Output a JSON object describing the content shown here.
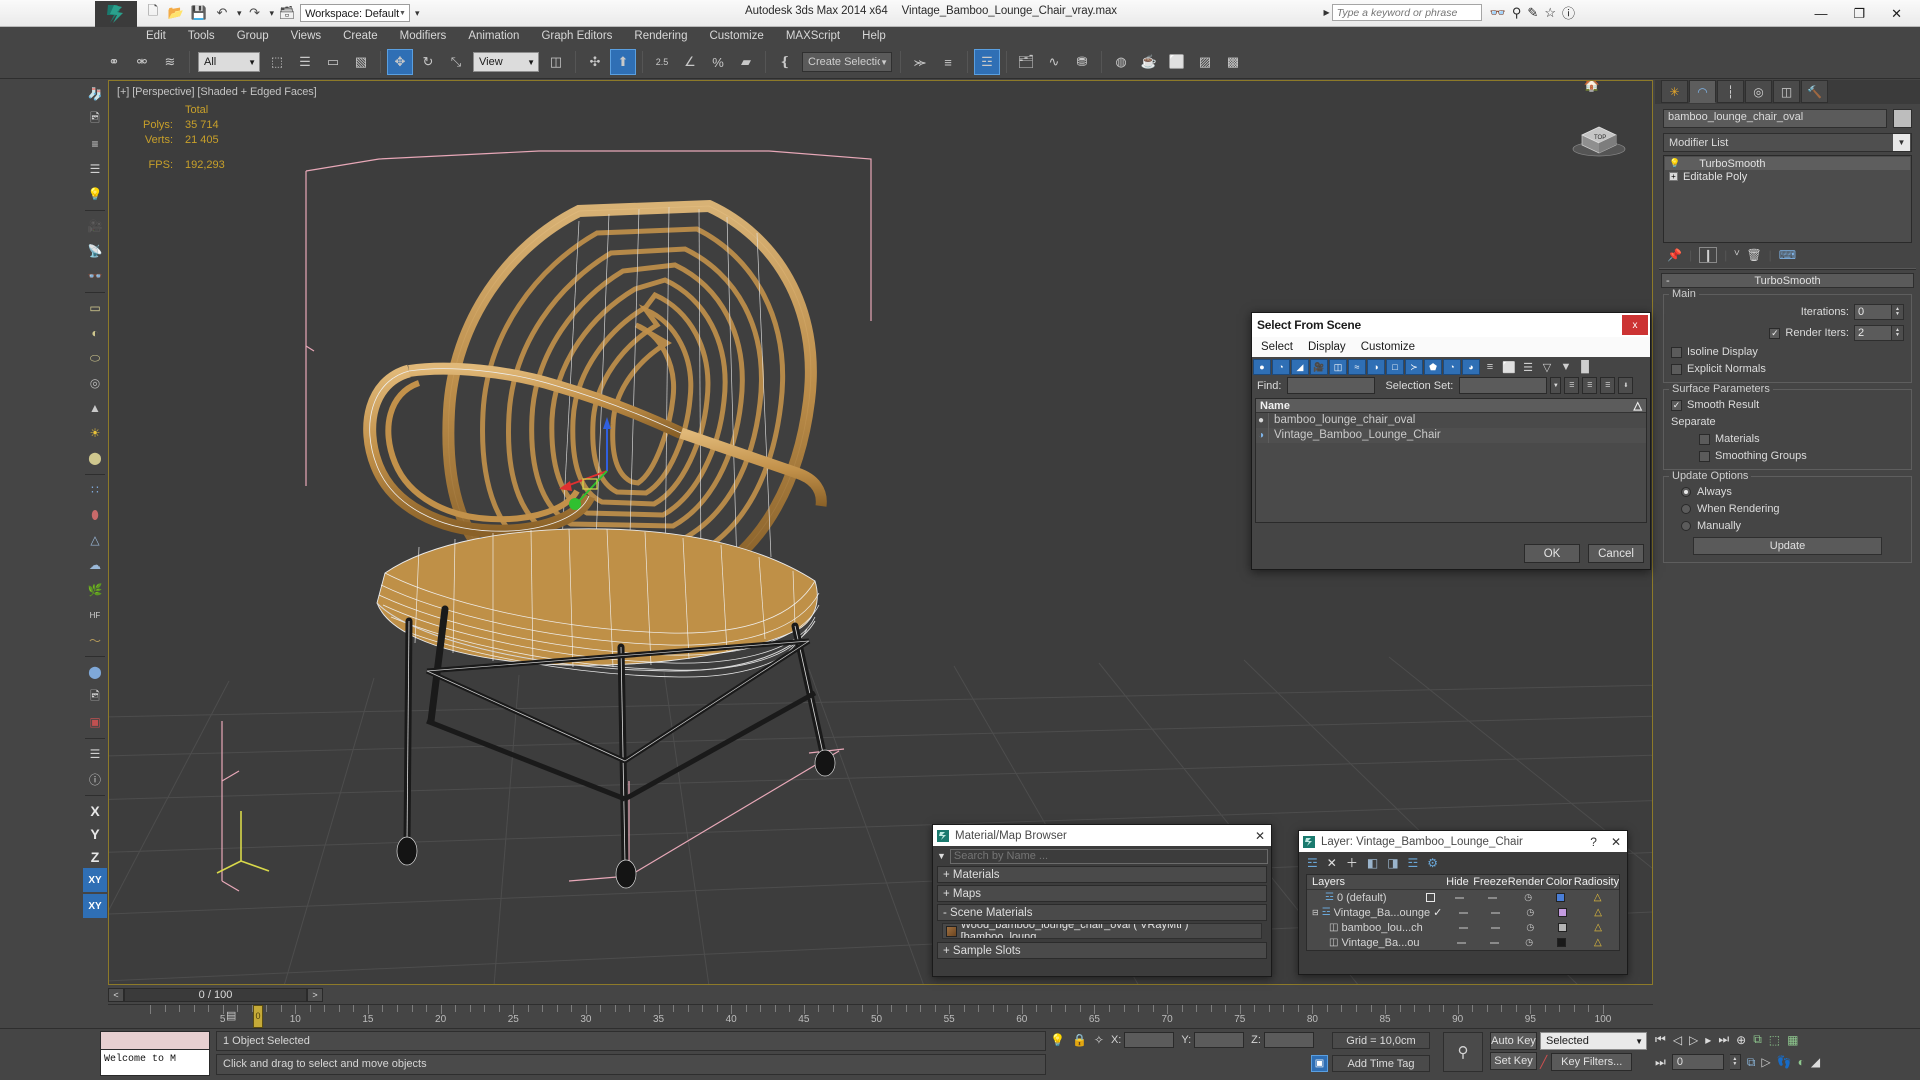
{
  "app": {
    "title": "Autodesk 3ds Max  2014 x64",
    "file": "Vintage_Bamboo_Lounge_Chair_vray.max",
    "workspace_label": "Workspace: Default"
  },
  "quick_access": [
    {
      "name": "new-icon",
      "glyph": "⬜"
    },
    {
      "name": "open-icon",
      "glyph": "📂"
    },
    {
      "name": "save-icon",
      "glyph": "💾"
    },
    {
      "name": "undo-icon",
      "glyph": "↶"
    },
    {
      "name": "redo-icon",
      "glyph": "↷"
    },
    {
      "name": "project-folder-icon",
      "glyph": "🗂"
    }
  ],
  "search": {
    "placeholder": "Type a keyword or phrase",
    "icons": [
      {
        "name": "search-binoculars-icon",
        "glyph": "⚕"
      },
      {
        "name": "search-key-icon",
        "glyph": "🔑"
      },
      {
        "name": "search-cursor-icon",
        "glyph": "✐"
      },
      {
        "name": "favorites-star-icon",
        "glyph": "☆"
      },
      {
        "name": "help-question-icon",
        "glyph": "?"
      }
    ]
  },
  "window_controls": [
    {
      "name": "minimize-button",
      "glyph": "—"
    },
    {
      "name": "restore-button",
      "glyph": "❐"
    },
    {
      "name": "close-button",
      "glyph": "✕"
    }
  ],
  "menu": [
    "Edit",
    "Tools",
    "Group",
    "Views",
    "Create",
    "Modifiers",
    "Animation",
    "Graph Editors",
    "Rendering",
    "Customize",
    "MAXScript",
    "Help"
  ],
  "toolbar": {
    "selection_filter": "All",
    "reference_coord_system": "View",
    "named_selection_set_placeholder": "Create Selection Se",
    "items": [
      {
        "name": "select-and-link-icon",
        "glyph": "⚭",
        "active": false
      },
      {
        "name": "unlink-selection-icon",
        "glyph": "⚮",
        "active": false
      },
      {
        "name": "bind-to-space-warp-icon",
        "glyph": "≋",
        "active": false
      },
      {
        "name": "select-object-icon",
        "glyph": "⬚",
        "active": false
      },
      {
        "name": "select-by-name-icon",
        "glyph": "☰",
        "active": false
      },
      {
        "name": "rectangular-selection-region-icon",
        "glyph": "▭",
        "active": false
      },
      {
        "name": "window-crossing-icon",
        "glyph": "▧",
        "active": false
      },
      {
        "name": "select-and-move-icon",
        "glyph": "✥",
        "active": true
      },
      {
        "name": "select-and-rotate-icon",
        "glyph": "↻",
        "active": false
      },
      {
        "name": "select-and-scale-icon",
        "glyph": "⤡",
        "active": false
      },
      {
        "name": "use-center-flyout-icon",
        "glyph": "▣",
        "active": false
      },
      {
        "name": "select-and-manipulate-icon",
        "glyph": "✣",
        "active": false
      },
      {
        "name": "snaps-toggle-icon",
        "glyph": "⬆",
        "active": true
      },
      {
        "name": "angle-snap-toggle-icon",
        "glyph": "2.5",
        "active": false
      },
      {
        "name": "percent-snap-toggle-icon",
        "glyph": "∠",
        "active": false
      },
      {
        "name": "spinner-snap-toggle-icon",
        "glyph": "%",
        "active": false
      },
      {
        "name": "edit-named-selection-sets-icon",
        "glyph": "≡",
        "active": false
      },
      {
        "name": "mirror-icon",
        "glyph": "⫼",
        "active": false
      },
      {
        "name": "align-flyout-icon",
        "glyph": "⬛",
        "active": false
      },
      {
        "name": "layer-manager-icon",
        "glyph": "☰",
        "active": true
      },
      {
        "name": "toggle-scene-explorer-icon",
        "glyph": "⌸",
        "active": false
      },
      {
        "name": "curve-editor-icon",
        "glyph": "∿",
        "active": false
      },
      {
        "name": "schematic-view-icon",
        "glyph": "☰",
        "active": false
      },
      {
        "name": "material-editor-icon",
        "glyph": "◍",
        "active": false
      },
      {
        "name": "render-setup-icon",
        "glyph": "☕",
        "active": false
      },
      {
        "name": "rendered-frame-window-icon",
        "glyph": "⬜",
        "active": false
      },
      {
        "name": "render-production-icon",
        "glyph": "☕",
        "active": false
      }
    ]
  },
  "left_toolbar": [
    {
      "name": "teapot-icon",
      "glyph": "🫖"
    },
    {
      "name": "render-frame-icon",
      "glyph": "🖼"
    },
    {
      "name": "render-setup-panel-icon",
      "glyph": "≡"
    },
    {
      "name": "render-settings-icon",
      "glyph": "☰"
    },
    {
      "name": "light-bulb-icon",
      "glyph": "💡"
    },
    {
      "name": "camera-icon",
      "glyph": "🎥"
    },
    {
      "name": "target-camera-icon",
      "glyph": "📡"
    },
    {
      "name": "stereo-camera-icon",
      "glyph": "👓"
    },
    {
      "name": "box-primitive-icon",
      "glyph": "▭"
    },
    {
      "name": "sphere-primitive-icon",
      "glyph": "◔"
    },
    {
      "name": "cylinder-primitive-icon",
      "glyph": "⬭"
    },
    {
      "name": "torus-primitive-icon",
      "glyph": "◎"
    },
    {
      "name": "cone-primitive-icon",
      "glyph": "▲"
    },
    {
      "name": "sun-light-icon",
      "glyph": "☀"
    },
    {
      "name": "geosphere-icon",
      "glyph": "⬤"
    },
    {
      "name": "particle-system-icon",
      "glyph": "∷"
    },
    {
      "name": "blobmesh-icon",
      "glyph": "⬮"
    },
    {
      "name": "space-warp-icon",
      "glyph": "△"
    },
    {
      "name": "cloud-icon",
      "glyph": "☁"
    },
    {
      "name": "grass-icon",
      "glyph": "🌿"
    },
    {
      "name": "hair-and-fur-icon",
      "glyph": "HF"
    },
    {
      "name": "fur-modifier-icon",
      "glyph": "〜"
    },
    {
      "name": "material-sphere-icon",
      "glyph": "⬤"
    },
    {
      "name": "material-browser-icon",
      "glyph": "🖼"
    },
    {
      "name": "select-region-icon",
      "glyph": "⬚"
    },
    {
      "name": "dialog-icon",
      "glyph": "☰"
    },
    {
      "name": "help-icon",
      "glyph": "?"
    }
  ],
  "axis_constraints": [
    "X",
    "Y",
    "Z",
    "XY"
  ],
  "viewport": {
    "label": "[+] [Perspective] [Shaded + Edged Faces]",
    "stats": {
      "header": "Total",
      "rows": [
        {
          "label": "Polys:",
          "value": "35 714"
        },
        {
          "label": "Verts:",
          "value": "21 405"
        }
      ],
      "fps_label": "FPS:",
      "fps_value": "192,293"
    }
  },
  "command_panel": {
    "tabs": [
      {
        "name": "create-tab",
        "glyph": "✳",
        "active": false
      },
      {
        "name": "modify-tab",
        "glyph": "◠",
        "active": true
      },
      {
        "name": "hierarchy-tab",
        "glyph": "⑂",
        "active": false
      },
      {
        "name": "motion-tab",
        "glyph": "◎",
        "active": false
      },
      {
        "name": "display-tab",
        "glyph": "▣",
        "active": false
      },
      {
        "name": "utilities-tab",
        "glyph": "🔨",
        "active": false
      }
    ],
    "object_name": "bamboo_lounge_chair_oval",
    "modifier_list_label": "Modifier List",
    "stack": [
      {
        "label": "TurboSmooth",
        "selected": true
      },
      {
        "label": "Editable Poly",
        "selected": false
      }
    ],
    "stack_tools": [
      {
        "name": "pin-stack-icon",
        "glyph": "📌"
      },
      {
        "name": "show-end-result-icon",
        "glyph": "❙"
      },
      {
        "name": "make-unique-icon",
        "glyph": "ⱽ"
      },
      {
        "name": "remove-modifier-icon",
        "glyph": "🗑"
      },
      {
        "name": "configure-modifier-sets-icon",
        "glyph": "⌸"
      }
    ],
    "turbosmooth": {
      "rollout_title": "TurboSmooth",
      "main_group": "Main",
      "iterations_label": "Iterations:",
      "iterations_value": "0",
      "render_iters_label": "Render Iters:",
      "render_iters_value": "2",
      "render_iters_checked": true,
      "isoline_display_label": "Isoline Display",
      "isoline_display_checked": false,
      "explicit_normals_label": "Explicit Normals",
      "explicit_normals_checked": false,
      "surface_group": "Surface Parameters",
      "smooth_result_label": "Smooth Result",
      "smooth_result_checked": true,
      "separate_label": "Separate",
      "materials_label": "Materials",
      "materials_checked": false,
      "smoothing_groups_label": "Smoothing Groups",
      "smoothing_groups_checked": false,
      "update_group": "Update Options",
      "always_label": "Always",
      "when_rendering_label": "When Rendering",
      "manually_label": "Manually",
      "selected_update": "Always",
      "update_button": "Update"
    }
  },
  "select_from_scene": {
    "title": "Select From Scene",
    "close_label": "x",
    "menu": [
      "Select",
      "Display",
      "Customize"
    ],
    "filter_icons": [
      {
        "name": "display-geometry-icon",
        "glyph": "●",
        "on": true
      },
      {
        "name": "display-shapes-icon",
        "glyph": "◐",
        "on": true
      },
      {
        "name": "display-lights-icon",
        "glyph": "◢",
        "on": true
      },
      {
        "name": "display-cameras-icon",
        "glyph": "🎥",
        "on": true
      },
      {
        "name": "display-helpers-icon",
        "glyph": "▣",
        "on": true
      },
      {
        "name": "display-space-warps-icon",
        "glyph": "≈",
        "on": true
      },
      {
        "name": "display-groups-icon",
        "glyph": "◑",
        "on": true
      },
      {
        "name": "display-xrefs-icon",
        "glyph": "□",
        "on": true
      },
      {
        "name": "display-bones-icon",
        "glyph": "≻",
        "on": true
      },
      {
        "name": "display-containers-icon",
        "glyph": "⬟",
        "on": true
      },
      {
        "name": "display-selected-icon",
        "glyph": "◔",
        "on": true
      },
      {
        "name": "display-unselected-icon",
        "glyph": "◕",
        "on": true
      },
      {
        "name": "expand-all-icon",
        "glyph": "≡",
        "on": false
      },
      {
        "name": "collapse-all-icon",
        "glyph": "⬜",
        "on": false
      },
      {
        "name": "display-children-icon",
        "glyph": "☰",
        "on": false
      },
      {
        "name": "filter-funnel-icon",
        "glyph": "▽",
        "on": false
      },
      {
        "name": "advanced-filter-icon",
        "glyph": "▼",
        "on": false
      },
      {
        "name": "layer-filter-icon",
        "glyph": "⬛",
        "on": false
      }
    ],
    "find_label": "Find:",
    "find_value": "",
    "selection_set_label": "Selection Set:",
    "selection_set_value": "",
    "set_buttons": [
      {
        "name": "add-selection-set-icon",
        "glyph": "☰"
      },
      {
        "name": "remove-selection-set-icon",
        "glyph": "☰"
      },
      {
        "name": "edit-selection-set-icon",
        "glyph": "☰"
      },
      {
        "name": "selection-set-options-icon",
        "glyph": "⬇"
      }
    ],
    "column_header": "Name",
    "sort_glyph": "△",
    "rows": [
      {
        "name": "bamboo_lounge_chair_oval",
        "icon": "sphere-object-icon",
        "glyph": "●"
      },
      {
        "name": "Vintage_Bamboo_Lounge_Chair",
        "icon": "group-object-icon",
        "glyph": "◑"
      }
    ],
    "ok_label": "OK",
    "cancel_label": "Cancel"
  },
  "material_browser": {
    "title": "Material/Map Browser",
    "close_glyph": "✕",
    "search_placeholder": "Search by Name ...",
    "groups": [
      {
        "label": "+ Materials"
      },
      {
        "label": "+ Maps"
      },
      {
        "label": "- Scene Materials"
      }
    ],
    "scene_material": "Wood_bamboo_lounge_chair_oval ( VRayMtl ) [bamboo_loung...",
    "sample_slots": "+ Sample Slots"
  },
  "layer_dialog": {
    "title": "Layer: Vintage_Bamboo_Lounge_Chair",
    "help_glyph": "?",
    "close_glyph": "✕",
    "tools": [
      {
        "name": "create-new-layer-icon",
        "glyph": "☰"
      },
      {
        "name": "delete-layer-icon",
        "glyph": "✕"
      },
      {
        "name": "add-selection-to-layer-icon",
        "glyph": "＋"
      },
      {
        "name": "select-objects-in-layer-icon",
        "glyph": "◧"
      },
      {
        "name": "highlight-selected-objects-icon",
        "glyph": "◨"
      },
      {
        "name": "set-current-layer-icon",
        "glyph": "☰"
      },
      {
        "name": "layer-properties-icon",
        "glyph": "⚙"
      }
    ],
    "columns": [
      "Layers",
      "",
      "Hide",
      "Freeze",
      "Render",
      "Color",
      "Radiosity"
    ],
    "rows": [
      {
        "name": "0 (default)",
        "indent": 0,
        "kind": "layer",
        "active_box": true,
        "check": false,
        "color": "#4a7ed6"
      },
      {
        "name": "Vintage_Ba...ounge",
        "indent": 0,
        "kind": "layer",
        "active_box": false,
        "check": true,
        "color": "#c49be0",
        "expander": "⊟"
      },
      {
        "name": "bamboo_lou...ch",
        "indent": 1,
        "kind": "object",
        "active_box": false,
        "check": false,
        "color": "#b5b5b5"
      },
      {
        "name": "Vintage_Ba...ou",
        "indent": 1,
        "kind": "object",
        "active_box": false,
        "check": false,
        "color": "#1a1a1a"
      }
    ]
  },
  "timeline": {
    "current_frame": "0 / 100",
    "prev_glyph": "<",
    "next_glyph": ">",
    "ticks": [
      0,
      5,
      10,
      15,
      20,
      25,
      30,
      35,
      40,
      45,
      50,
      55,
      60,
      65,
      70,
      75,
      80,
      85,
      90,
      95,
      100
    ]
  },
  "status_bar": {
    "maxscript_listener_text": "Welcome to M",
    "selection_status": "1 Object Selected",
    "prompt": "Click and drag to select and move objects",
    "coord_x_label": "X:",
    "coord_x_value": "",
    "coord_y_label": "Y:",
    "coord_y_value": "",
    "coord_z_label": "Z:",
    "coord_z_value": "",
    "grid_text": "Grid = 10,0cm",
    "add_time_tag": "Add Time Tag",
    "auto_key": "Auto Key",
    "set_key": "Set Key",
    "key_mode_value": "Selected",
    "key_filters": "Key Filters...",
    "playback_frame": "0",
    "icons": [
      {
        "name": "isolate-selection-icon",
        "glyph": "💡"
      },
      {
        "name": "selection-lock-icon",
        "glyph": "🔒"
      },
      {
        "name": "absolute-relative-transform-icon",
        "glyph": "✣"
      }
    ],
    "playback": [
      {
        "name": "go-to-start-icon",
        "glyph": "⏮"
      },
      {
        "name": "previous-frame-icon",
        "glyph": "◁"
      },
      {
        "name": "play-animation-icon",
        "glyph": "▷"
      },
      {
        "name": "next-frame-icon",
        "glyph": "▷"
      },
      {
        "name": "go-to-end-icon",
        "glyph": "⏭"
      },
      {
        "name": "zoom-region-icon",
        "glyph": "⊕"
      },
      {
        "name": "zoom-extents-icon",
        "glyph": "⧉"
      },
      {
        "name": "zoom-extents-all-icon",
        "glyph": "⬚"
      },
      {
        "name": "maximize-viewport-icon",
        "glyph": "⬛"
      }
    ],
    "playback2": [
      {
        "name": "key-mode-toggle-icon",
        "glyph": "⏭"
      },
      {
        "name": "time-configuration-icon",
        "glyph": "⧉"
      },
      {
        "name": "pan-view-icon",
        "glyph": "✋"
      },
      {
        "name": "orbit-icon",
        "glyph": "⟳"
      },
      {
        "name": "walkthrough-icon",
        "glyph": "👣"
      },
      {
        "name": "field-of-view-icon",
        "glyph": "◔"
      },
      {
        "name": "maximize-viewport-toggle-icon",
        "glyph": "⬚"
      }
    ]
  },
  "colors": {
    "accent_blue": "#2f6fb5",
    "panel_bg": "#454545",
    "viewport_bg": "#3d3d3d",
    "viewport_border": "#8d7a29",
    "stats_yellow": "#c8a02a",
    "close_red": "#cc3333",
    "bamboo_tan": "#c99a52",
    "gizmo_red": "#e03030",
    "gizmo_green": "#30c030",
    "gizmo_blue": "#3060e0",
    "selection_pink": "#e8a8b8"
  }
}
